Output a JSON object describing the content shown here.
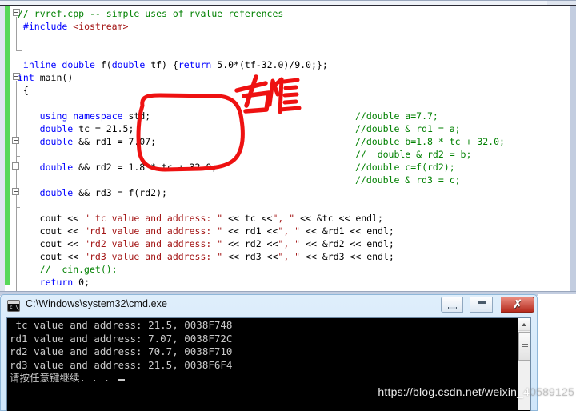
{
  "editor": {
    "name": "visual-studio-code-editor",
    "code_lines": [
      {
        "indent": 0,
        "segments": [
          {
            "t": "// rvref.cpp -- simple uses of rvalue references",
            "c": "cmt"
          }
        ]
      },
      {
        "indent": 1,
        "segments": [
          {
            "t": "#include ",
            "c": "pp"
          },
          {
            "t": "<iostream>",
            "c": "inc"
          }
        ]
      },
      {
        "indent": 0,
        "segments": []
      },
      {
        "indent": 0,
        "segments": []
      },
      {
        "indent": 1,
        "segments": [
          {
            "t": "inline",
            "c": "kw"
          },
          {
            "t": " ",
            "c": "plain"
          },
          {
            "t": "double",
            "c": "kw"
          },
          {
            "t": " f(",
            "c": "plain"
          },
          {
            "t": "double",
            "c": "kw"
          },
          {
            "t": " tf) {",
            "c": "plain"
          },
          {
            "t": "return",
            "c": "kw"
          },
          {
            "t": " 5.0*(tf-32.0)/9.0;};",
            "c": "plain"
          }
        ]
      },
      {
        "indent": 0,
        "segments": [
          {
            "t": "int",
            "c": "kw"
          },
          {
            "t": " main()",
            "c": "plain"
          }
        ]
      },
      {
        "indent": 1,
        "segments": [
          {
            "t": "{",
            "c": "plain"
          }
        ]
      },
      {
        "indent": 0,
        "segments": []
      },
      {
        "indent": 4,
        "segments": [
          {
            "t": "using",
            "c": "kw"
          },
          {
            "t": " ",
            "c": "plain"
          },
          {
            "t": "namespace",
            "c": "kw"
          },
          {
            "t": " std;",
            "c": "plain"
          }
        ]
      },
      {
        "indent": 4,
        "segments": [
          {
            "t": "double",
            "c": "kw"
          },
          {
            "t": " tc = 21.5;",
            "c": "plain"
          }
        ]
      },
      {
        "indent": 4,
        "segments": [
          {
            "t": "double",
            "c": "kw"
          },
          {
            "t": " && rd1 = 7.07;",
            "c": "plain"
          }
        ]
      },
      {
        "indent": 0,
        "segments": []
      },
      {
        "indent": 4,
        "segments": [
          {
            "t": "double",
            "c": "kw"
          },
          {
            "t": " && rd2 = 1.8 * tc + 32.0;",
            "c": "plain"
          }
        ]
      },
      {
        "indent": 0,
        "segments": []
      },
      {
        "indent": 4,
        "segments": [
          {
            "t": "double",
            "c": "kw"
          },
          {
            "t": " && rd3 = f(rd2);",
            "c": "plain"
          }
        ]
      },
      {
        "indent": 0,
        "segments": []
      },
      {
        "indent": 4,
        "segments": [
          {
            "t": "cout << ",
            "c": "plain"
          },
          {
            "t": "\" tc value and address: \"",
            "c": "str"
          },
          {
            "t": " << tc <<",
            "c": "plain"
          },
          {
            "t": "\", \"",
            "c": "str"
          },
          {
            "t": " << &tc << endl;",
            "c": "plain"
          }
        ]
      },
      {
        "indent": 4,
        "segments": [
          {
            "t": "cout << ",
            "c": "plain"
          },
          {
            "t": "\"rd1 value and address: \"",
            "c": "str"
          },
          {
            "t": " << rd1 <<",
            "c": "plain"
          },
          {
            "t": "\", \"",
            "c": "str"
          },
          {
            "t": " << &rd1 << endl;",
            "c": "plain"
          }
        ]
      },
      {
        "indent": 4,
        "segments": [
          {
            "t": "cout << ",
            "c": "plain"
          },
          {
            "t": "\"rd2 value and address: \"",
            "c": "str"
          },
          {
            "t": " << rd2 <<",
            "c": "plain"
          },
          {
            "t": "\", \"",
            "c": "str"
          },
          {
            "t": " << &rd2 << endl;",
            "c": "plain"
          }
        ]
      },
      {
        "indent": 4,
        "segments": [
          {
            "t": "cout << ",
            "c": "plain"
          },
          {
            "t": "\"rd3 value and address: \"",
            "c": "str"
          },
          {
            "t": " << rd3 <<",
            "c": "plain"
          },
          {
            "t": "\", \"",
            "c": "str"
          },
          {
            "t": " << &rd3 << endl;",
            "c": "plain"
          }
        ]
      },
      {
        "indent": 4,
        "segments": [
          {
            "t": "//  cin.get();",
            "c": "cmt"
          }
        ]
      },
      {
        "indent": 4,
        "segments": [
          {
            "t": "return",
            "c": "kw"
          },
          {
            "t": " 0;",
            "c": "plain"
          }
        ]
      },
      {
        "indent": 1,
        "segments": [
          {
            "t": "}",
            "c": "plain"
          }
        ]
      }
    ],
    "right_comments": [
      "//double a=7.7;",
      "//double & rd1 = a;",
      "//double b=1.8 * tc + 32.0;",
      "//  double & rd2 = b;",
      "//double c=f(rd2);",
      "//double & rd3 = c;"
    ],
    "right_comments_start_line": 8,
    "annotation": {
      "handwriting_text": "右值",
      "ink_color": "#ee1111",
      "circled_lines": "rd1 / rd2 / rd3 initializer expressions"
    },
    "colors": {
      "comment": "#008000",
      "keyword": "#0000ff",
      "string": "#a31515",
      "change_bar": "#58d858",
      "background": "#ffffff"
    }
  },
  "console": {
    "title": "C:\\Windows\\system32\\cmd.exe",
    "icon": "cmd-console-icon",
    "buttons": {
      "minimize": "minimize-button",
      "maximize": "maximize-button",
      "close": "✗"
    },
    "output_lines": [
      " tc value and address: 21.5, 0038F748",
      "rd1 value and address: 7.07, 0038F72C",
      "rd2 value and address: 70.7, 0038F710",
      "rd3 value and address: 21.5, 0038F6F4",
      "请按任意键继续. . ."
    ],
    "background": "#000000",
    "foreground": "#c8c8c8"
  },
  "watermark": {
    "text_visible": "https://blog.csdn.net/weixin_4",
    "text_faded": "0589125",
    "full": "https://blog.csdn.net/weixin_40589125"
  }
}
